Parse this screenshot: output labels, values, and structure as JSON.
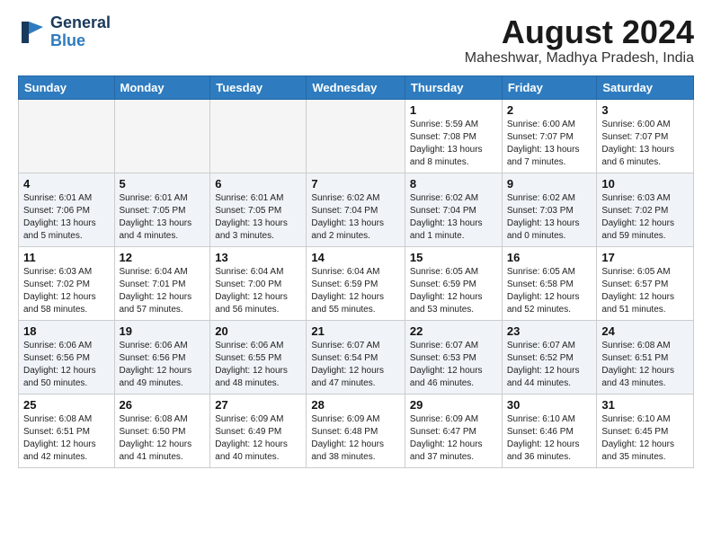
{
  "header": {
    "logo_general": "General",
    "logo_blue": "Blue",
    "month_year": "August 2024",
    "location": "Maheshwar, Madhya Pradesh, India"
  },
  "weekdays": [
    "Sunday",
    "Monday",
    "Tuesday",
    "Wednesday",
    "Thursday",
    "Friday",
    "Saturday"
  ],
  "weeks": [
    [
      {
        "day": "",
        "info": ""
      },
      {
        "day": "",
        "info": ""
      },
      {
        "day": "",
        "info": ""
      },
      {
        "day": "",
        "info": ""
      },
      {
        "day": "1",
        "info": "Sunrise: 5:59 AM\nSunset: 7:08 PM\nDaylight: 13 hours\nand 8 minutes."
      },
      {
        "day": "2",
        "info": "Sunrise: 6:00 AM\nSunset: 7:07 PM\nDaylight: 13 hours\nand 7 minutes."
      },
      {
        "day": "3",
        "info": "Sunrise: 6:00 AM\nSunset: 7:07 PM\nDaylight: 13 hours\nand 6 minutes."
      }
    ],
    [
      {
        "day": "4",
        "info": "Sunrise: 6:01 AM\nSunset: 7:06 PM\nDaylight: 13 hours\nand 5 minutes."
      },
      {
        "day": "5",
        "info": "Sunrise: 6:01 AM\nSunset: 7:05 PM\nDaylight: 13 hours\nand 4 minutes."
      },
      {
        "day": "6",
        "info": "Sunrise: 6:01 AM\nSunset: 7:05 PM\nDaylight: 13 hours\nand 3 minutes."
      },
      {
        "day": "7",
        "info": "Sunrise: 6:02 AM\nSunset: 7:04 PM\nDaylight: 13 hours\nand 2 minutes."
      },
      {
        "day": "8",
        "info": "Sunrise: 6:02 AM\nSunset: 7:04 PM\nDaylight: 13 hours\nand 1 minute."
      },
      {
        "day": "9",
        "info": "Sunrise: 6:02 AM\nSunset: 7:03 PM\nDaylight: 13 hours\nand 0 minutes."
      },
      {
        "day": "10",
        "info": "Sunrise: 6:03 AM\nSunset: 7:02 PM\nDaylight: 12 hours\nand 59 minutes."
      }
    ],
    [
      {
        "day": "11",
        "info": "Sunrise: 6:03 AM\nSunset: 7:02 PM\nDaylight: 12 hours\nand 58 minutes."
      },
      {
        "day": "12",
        "info": "Sunrise: 6:04 AM\nSunset: 7:01 PM\nDaylight: 12 hours\nand 57 minutes."
      },
      {
        "day": "13",
        "info": "Sunrise: 6:04 AM\nSunset: 7:00 PM\nDaylight: 12 hours\nand 56 minutes."
      },
      {
        "day": "14",
        "info": "Sunrise: 6:04 AM\nSunset: 6:59 PM\nDaylight: 12 hours\nand 55 minutes."
      },
      {
        "day": "15",
        "info": "Sunrise: 6:05 AM\nSunset: 6:59 PM\nDaylight: 12 hours\nand 53 minutes."
      },
      {
        "day": "16",
        "info": "Sunrise: 6:05 AM\nSunset: 6:58 PM\nDaylight: 12 hours\nand 52 minutes."
      },
      {
        "day": "17",
        "info": "Sunrise: 6:05 AM\nSunset: 6:57 PM\nDaylight: 12 hours\nand 51 minutes."
      }
    ],
    [
      {
        "day": "18",
        "info": "Sunrise: 6:06 AM\nSunset: 6:56 PM\nDaylight: 12 hours\nand 50 minutes."
      },
      {
        "day": "19",
        "info": "Sunrise: 6:06 AM\nSunset: 6:56 PM\nDaylight: 12 hours\nand 49 minutes."
      },
      {
        "day": "20",
        "info": "Sunrise: 6:06 AM\nSunset: 6:55 PM\nDaylight: 12 hours\nand 48 minutes."
      },
      {
        "day": "21",
        "info": "Sunrise: 6:07 AM\nSunset: 6:54 PM\nDaylight: 12 hours\nand 47 minutes."
      },
      {
        "day": "22",
        "info": "Sunrise: 6:07 AM\nSunset: 6:53 PM\nDaylight: 12 hours\nand 46 minutes."
      },
      {
        "day": "23",
        "info": "Sunrise: 6:07 AM\nSunset: 6:52 PM\nDaylight: 12 hours\nand 44 minutes."
      },
      {
        "day": "24",
        "info": "Sunrise: 6:08 AM\nSunset: 6:51 PM\nDaylight: 12 hours\nand 43 minutes."
      }
    ],
    [
      {
        "day": "25",
        "info": "Sunrise: 6:08 AM\nSunset: 6:51 PM\nDaylight: 12 hours\nand 42 minutes."
      },
      {
        "day": "26",
        "info": "Sunrise: 6:08 AM\nSunset: 6:50 PM\nDaylight: 12 hours\nand 41 minutes."
      },
      {
        "day": "27",
        "info": "Sunrise: 6:09 AM\nSunset: 6:49 PM\nDaylight: 12 hours\nand 40 minutes."
      },
      {
        "day": "28",
        "info": "Sunrise: 6:09 AM\nSunset: 6:48 PM\nDaylight: 12 hours\nand 38 minutes."
      },
      {
        "day": "29",
        "info": "Sunrise: 6:09 AM\nSunset: 6:47 PM\nDaylight: 12 hours\nand 37 minutes."
      },
      {
        "day": "30",
        "info": "Sunrise: 6:10 AM\nSunset: 6:46 PM\nDaylight: 12 hours\nand 36 minutes."
      },
      {
        "day": "31",
        "info": "Sunrise: 6:10 AM\nSunset: 6:45 PM\nDaylight: 12 hours\nand 35 minutes."
      }
    ]
  ]
}
